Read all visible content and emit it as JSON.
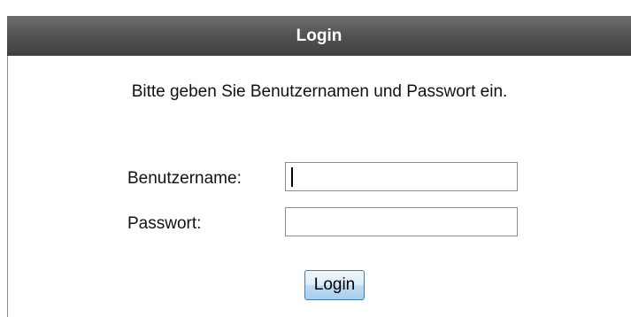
{
  "header": {
    "title": "Login"
  },
  "instruction": "Bitte geben Sie Benutzernamen und Passwort ein.",
  "form": {
    "username_label": "Benutzername:",
    "username_value": "",
    "password_label": "Passwort:",
    "password_value": "",
    "submit_label": "Login"
  },
  "colors": {
    "header_bg": "#555555",
    "header_text": "#ffffff",
    "button_border": "#3c7fb1"
  }
}
